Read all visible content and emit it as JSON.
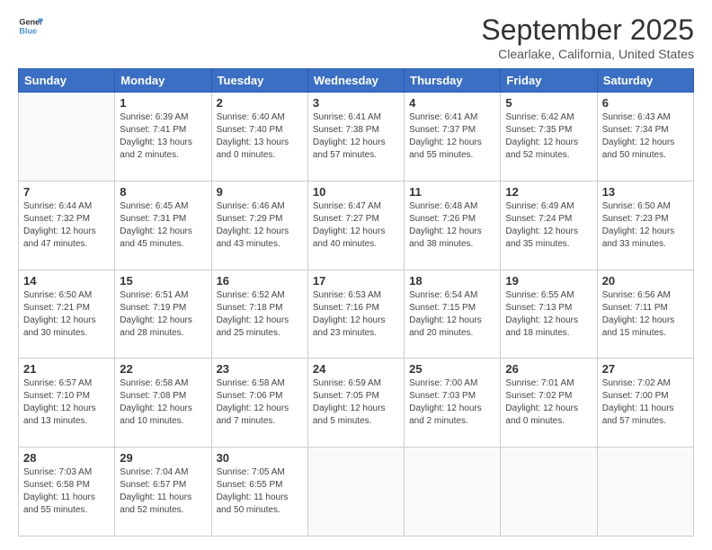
{
  "header": {
    "logo_line1": "General",
    "logo_line2": "Blue",
    "month": "September 2025",
    "location": "Clearlake, California, United States"
  },
  "weekdays": [
    "Sunday",
    "Monday",
    "Tuesday",
    "Wednesday",
    "Thursday",
    "Friday",
    "Saturday"
  ],
  "weeks": [
    [
      {
        "day": "",
        "info": ""
      },
      {
        "day": "1",
        "info": "Sunrise: 6:39 AM\nSunset: 7:41 PM\nDaylight: 13 hours\nand 2 minutes."
      },
      {
        "day": "2",
        "info": "Sunrise: 6:40 AM\nSunset: 7:40 PM\nDaylight: 13 hours\nand 0 minutes."
      },
      {
        "day": "3",
        "info": "Sunrise: 6:41 AM\nSunset: 7:38 PM\nDaylight: 12 hours\nand 57 minutes."
      },
      {
        "day": "4",
        "info": "Sunrise: 6:41 AM\nSunset: 7:37 PM\nDaylight: 12 hours\nand 55 minutes."
      },
      {
        "day": "5",
        "info": "Sunrise: 6:42 AM\nSunset: 7:35 PM\nDaylight: 12 hours\nand 52 minutes."
      },
      {
        "day": "6",
        "info": "Sunrise: 6:43 AM\nSunset: 7:34 PM\nDaylight: 12 hours\nand 50 minutes."
      }
    ],
    [
      {
        "day": "7",
        "info": "Sunrise: 6:44 AM\nSunset: 7:32 PM\nDaylight: 12 hours\nand 47 minutes."
      },
      {
        "day": "8",
        "info": "Sunrise: 6:45 AM\nSunset: 7:31 PM\nDaylight: 12 hours\nand 45 minutes."
      },
      {
        "day": "9",
        "info": "Sunrise: 6:46 AM\nSunset: 7:29 PM\nDaylight: 12 hours\nand 43 minutes."
      },
      {
        "day": "10",
        "info": "Sunrise: 6:47 AM\nSunset: 7:27 PM\nDaylight: 12 hours\nand 40 minutes."
      },
      {
        "day": "11",
        "info": "Sunrise: 6:48 AM\nSunset: 7:26 PM\nDaylight: 12 hours\nand 38 minutes."
      },
      {
        "day": "12",
        "info": "Sunrise: 6:49 AM\nSunset: 7:24 PM\nDaylight: 12 hours\nand 35 minutes."
      },
      {
        "day": "13",
        "info": "Sunrise: 6:50 AM\nSunset: 7:23 PM\nDaylight: 12 hours\nand 33 minutes."
      }
    ],
    [
      {
        "day": "14",
        "info": "Sunrise: 6:50 AM\nSunset: 7:21 PM\nDaylight: 12 hours\nand 30 minutes."
      },
      {
        "day": "15",
        "info": "Sunrise: 6:51 AM\nSunset: 7:19 PM\nDaylight: 12 hours\nand 28 minutes."
      },
      {
        "day": "16",
        "info": "Sunrise: 6:52 AM\nSunset: 7:18 PM\nDaylight: 12 hours\nand 25 minutes."
      },
      {
        "day": "17",
        "info": "Sunrise: 6:53 AM\nSunset: 7:16 PM\nDaylight: 12 hours\nand 23 minutes."
      },
      {
        "day": "18",
        "info": "Sunrise: 6:54 AM\nSunset: 7:15 PM\nDaylight: 12 hours\nand 20 minutes."
      },
      {
        "day": "19",
        "info": "Sunrise: 6:55 AM\nSunset: 7:13 PM\nDaylight: 12 hours\nand 18 minutes."
      },
      {
        "day": "20",
        "info": "Sunrise: 6:56 AM\nSunset: 7:11 PM\nDaylight: 12 hours\nand 15 minutes."
      }
    ],
    [
      {
        "day": "21",
        "info": "Sunrise: 6:57 AM\nSunset: 7:10 PM\nDaylight: 12 hours\nand 13 minutes."
      },
      {
        "day": "22",
        "info": "Sunrise: 6:58 AM\nSunset: 7:08 PM\nDaylight: 12 hours\nand 10 minutes."
      },
      {
        "day": "23",
        "info": "Sunrise: 6:58 AM\nSunset: 7:06 PM\nDaylight: 12 hours\nand 7 minutes."
      },
      {
        "day": "24",
        "info": "Sunrise: 6:59 AM\nSunset: 7:05 PM\nDaylight: 12 hours\nand 5 minutes."
      },
      {
        "day": "25",
        "info": "Sunrise: 7:00 AM\nSunset: 7:03 PM\nDaylight: 12 hours\nand 2 minutes."
      },
      {
        "day": "26",
        "info": "Sunrise: 7:01 AM\nSunset: 7:02 PM\nDaylight: 12 hours\nand 0 minutes."
      },
      {
        "day": "27",
        "info": "Sunrise: 7:02 AM\nSunset: 7:00 PM\nDaylight: 11 hours\nand 57 minutes."
      }
    ],
    [
      {
        "day": "28",
        "info": "Sunrise: 7:03 AM\nSunset: 6:58 PM\nDaylight: 11 hours\nand 55 minutes."
      },
      {
        "day": "29",
        "info": "Sunrise: 7:04 AM\nSunset: 6:57 PM\nDaylight: 11 hours\nand 52 minutes."
      },
      {
        "day": "30",
        "info": "Sunrise: 7:05 AM\nSunset: 6:55 PM\nDaylight: 11 hours\nand 50 minutes."
      },
      {
        "day": "",
        "info": ""
      },
      {
        "day": "",
        "info": ""
      },
      {
        "day": "",
        "info": ""
      },
      {
        "day": "",
        "info": ""
      }
    ]
  ]
}
